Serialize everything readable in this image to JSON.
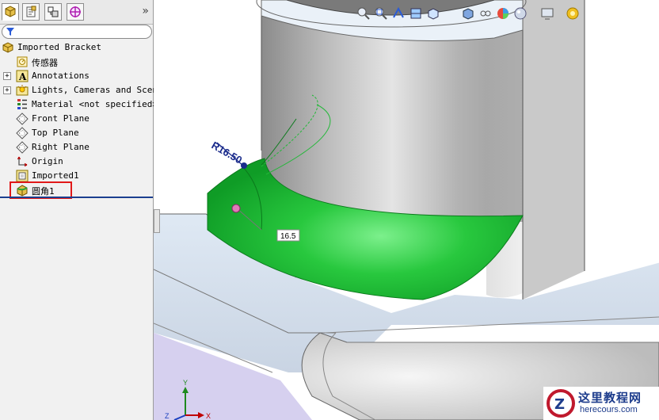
{
  "tree": {
    "root": "Imported Bracket",
    "items": [
      {
        "label": "传感器",
        "icon": "sensor-icon",
        "expandable": false
      },
      {
        "label": "Annotations",
        "icon": "annotations-icon",
        "expandable": true
      },
      {
        "label": "Lights, Cameras and Scene",
        "icon": "lights-icon",
        "expandable": true
      },
      {
        "label": "Material <not specified>",
        "icon": "material-icon",
        "expandable": false
      },
      {
        "label": "Front Plane",
        "icon": "plane-icon",
        "expandable": false
      },
      {
        "label": "Top Plane",
        "icon": "plane-icon",
        "expandable": false
      },
      {
        "label": "Right Plane",
        "icon": "plane-icon",
        "expandable": false
      },
      {
        "label": "Origin",
        "icon": "origin-icon",
        "expandable": false
      },
      {
        "label": "Imported1",
        "icon": "imported-feature-icon",
        "expandable": false
      },
      {
        "label": "圆角1",
        "icon": "fillet-icon",
        "expandable": false
      }
    ],
    "expand_symbol": "+"
  },
  "collapse_symbol": "»",
  "dimension": {
    "radius_label": "R16.50",
    "value_box": "16.5"
  },
  "triad": {
    "x": "X",
    "y": "Y",
    "z": "Z"
  },
  "watermark": {
    "title": "这里教程网",
    "url": "herecours.com",
    "logo_letter": "Z"
  },
  "colors": {
    "fillet_green": "#22c13a",
    "highlight_red": "#e11919",
    "dimension_blue": "#1b2c8c"
  }
}
